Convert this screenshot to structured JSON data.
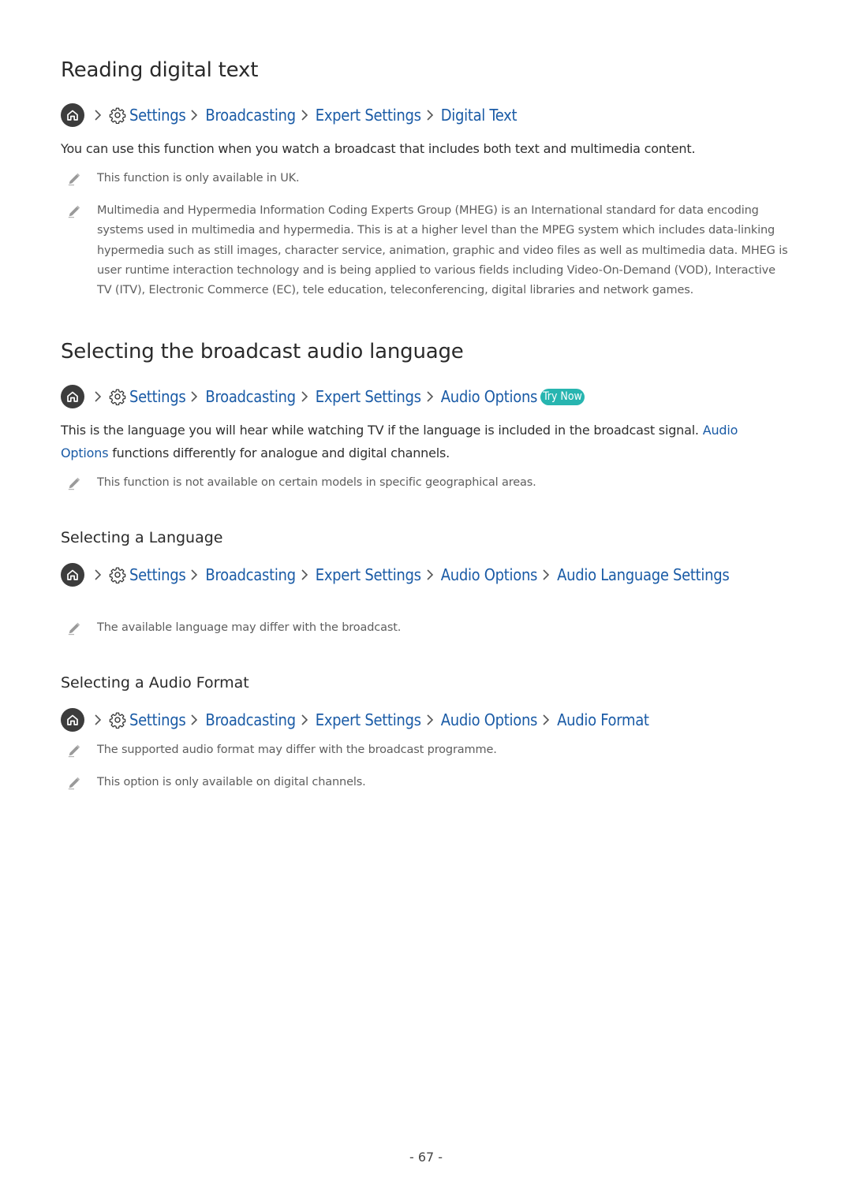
{
  "sections": [
    {
      "heading": "Reading digital text",
      "breadcrumb": [
        "Settings",
        "Broadcasting",
        "Expert Settings",
        "Digital Text"
      ],
      "body": "You can use this function when you watch a broadcast that includes both text and multimedia content.",
      "notes": [
        "This function is only available in UK.",
        "Multimedia and Hypermedia Information Coding Experts Group (MHEG) is an International standard for data encoding systems used in multimedia and hypermedia. This is at a higher level than the MPEG system which includes data-linking hypermedia such as still images, character service, animation, graphic and video files as well as multimedia data. MHEG is user runtime interaction technology and is being applied to various fields including Video-On-Demand (VOD), Interactive TV (ITV), Electronic Commerce (EC), tele education, teleconferencing, digital libraries and network games."
      ]
    },
    {
      "heading": "Selecting the broadcast audio language",
      "breadcrumb": [
        "Settings",
        "Broadcasting",
        "Expert Settings",
        "Audio Options"
      ],
      "try_now": "Try Now",
      "body_before": "This is the language you will hear while watching TV if the language is included in the broadcast signal. ",
      "body_link": "Audio Options",
      "body_after": " functions differently for analogue and digital channels.",
      "notes": [
        "This function is not available on certain models in specific geographical areas."
      ]
    },
    {
      "heading": "Selecting a Language",
      "breadcrumb": [
        "Settings",
        "Broadcasting",
        "Expert Settings",
        "Audio Options",
        "Audio Language Settings"
      ],
      "notes": [
        "The available language may differ with the broadcast."
      ]
    },
    {
      "heading": "Selecting a Audio Format",
      "breadcrumb": [
        "Settings",
        "Broadcasting",
        "Expert Settings",
        "Audio Options",
        "Audio Format"
      ],
      "notes": [
        "The supported audio format may differ with the broadcast programme.",
        "This option is only available on digital channels."
      ]
    }
  ],
  "page_number": "- 67 -",
  "icons": {
    "home": "home-icon",
    "gear": "gear-icon",
    "chevron": "chevron-right-icon",
    "note": "pencil-icon"
  },
  "colors": {
    "link": "#1a5ba6",
    "try_now_bg": "#27b5b0",
    "body_text": "#2f2f2f",
    "note_text": "#5e5e5e"
  }
}
